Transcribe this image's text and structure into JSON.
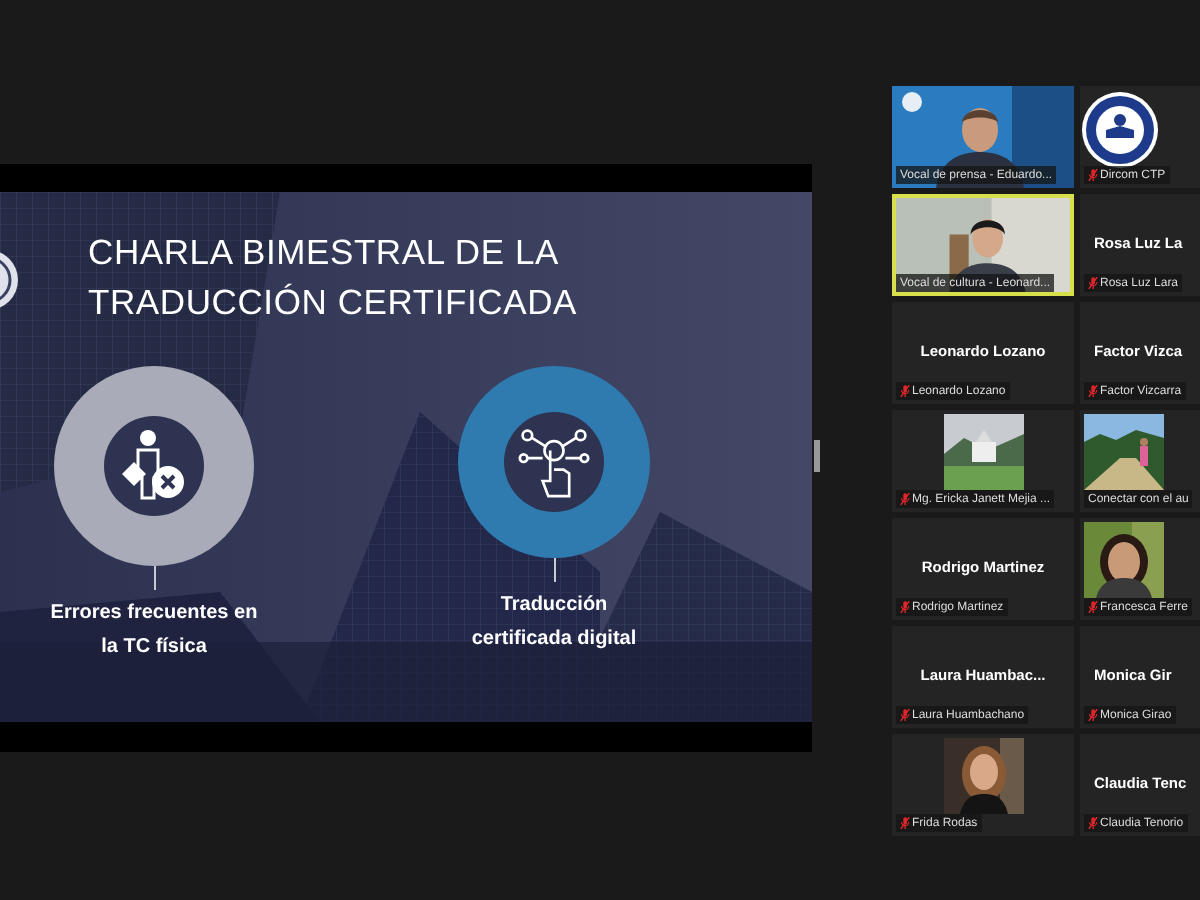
{
  "shared_screen": {
    "slide": {
      "title": "CHARLA BIMESTRAL DE LA TRADUCCIÓN CERTIFICADA",
      "topics": [
        {
          "kind": "errors",
          "label": "Errores frecuentes en la TC física"
        },
        {
          "kind": "digital",
          "label": "Traducción certificada digital"
        }
      ]
    }
  },
  "gallery": {
    "tiles": [
      {
        "kind": "video",
        "label": "Vocal de prensa - Eduardo...",
        "muted": false,
        "speaking": false
      },
      {
        "kind": "logo",
        "label": "Dircom CTP",
        "muted": true,
        "speaking": false
      },
      {
        "kind": "video",
        "label": "Vocal de cultura - Leonard...",
        "muted": false,
        "speaking": true
      },
      {
        "kind": "name",
        "name": "Rosa Luz La",
        "label": "Rosa Luz Lara",
        "muted": true,
        "speaking": false
      },
      {
        "kind": "name",
        "name": "Leonardo Lozano",
        "label": "Leonardo Lozano",
        "muted": true,
        "speaking": false
      },
      {
        "kind": "name",
        "name": "Factor Vizca",
        "label": "Factor Vizcarra",
        "muted": true,
        "speaking": false
      },
      {
        "label": "Mg. Ericka Janett Mejia ...",
        "muted": true,
        "speaking": false
      },
      {
        "label": "Conectar con el au",
        "muted": false,
        "speaking": false
      },
      {
        "kind": "name",
        "name": "Rodrigo Martinez",
        "label": "Rodrigo Martinez",
        "muted": true,
        "speaking": false
      },
      {
        "label": "Francesca Ferre",
        "muted": true,
        "speaking": false
      },
      {
        "kind": "name",
        "name": "Laura  Huambac...",
        "label": "Laura Huambachano",
        "muted": true,
        "speaking": false
      },
      {
        "kind": "name",
        "name": "Monica Gir",
        "label": "Monica Girao",
        "muted": true,
        "speaking": false
      },
      {
        "label": "Frida Rodas",
        "muted": true,
        "speaking": false
      },
      {
        "kind": "name",
        "name": "Claudia  Tenc",
        "label": "Claudia Tenorio",
        "muted": true,
        "speaking": false
      }
    ]
  }
}
